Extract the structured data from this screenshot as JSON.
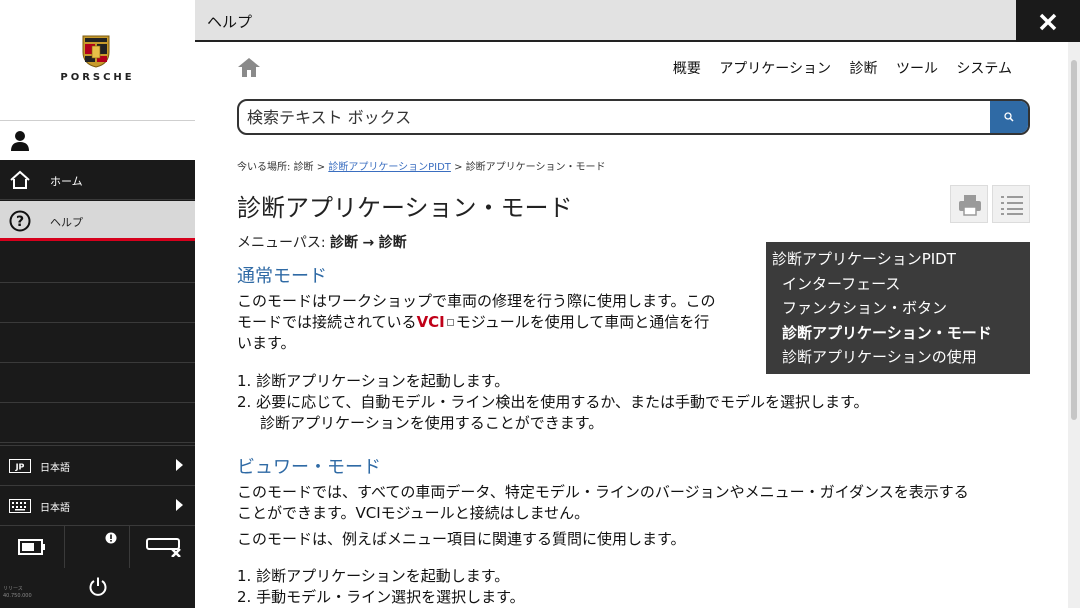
{
  "sidebar": {
    "brand": "PORSCHE",
    "nav": [
      {
        "label": "ホーム",
        "icon": "home-icon"
      },
      {
        "label": "ヘルプ",
        "icon": "help-icon"
      }
    ],
    "languages": [
      {
        "badge": "JP",
        "label": "日本語",
        "icon": "language-flag-icon"
      },
      {
        "label": "日本語",
        "icon": "keyboard-icon"
      }
    ],
    "version": [
      "リリース",
      "40.750.000"
    ]
  },
  "header": {
    "title": "ヘルプ"
  },
  "topnav": [
    "概要",
    "アプリケーション",
    "診断",
    "ツール",
    "システム"
  ],
  "search": {
    "placeholder": "検索テキスト ボックス"
  },
  "breadcrumb": {
    "prefix": "今いる場所:",
    "items": [
      "診断",
      "診断アプリケーションPIDT",
      "診断アプリケーション・モード"
    ],
    "sep": ">"
  },
  "page": {
    "title": "診断アプリケーション・モード",
    "menu_path_label": "メニューパス:",
    "menu_path_from": "診断",
    "menu_path_arrow": "→",
    "menu_path_to": "診断"
  },
  "toc": {
    "root": "診断アプリケーションPIDT",
    "items": [
      "インターフェース",
      "ファンクション・ボタン",
      "診断アプリケーション・モード",
      "診断アプリケーションの使用"
    ]
  },
  "sections": {
    "normal": {
      "heading": "通常モード",
      "para_line1": "このモードはワークショップで車両の修理を行う際に使用します。この",
      "para_line2_a": "モードでは接続されている",
      "para_line2_vci": "VCI",
      "para_line2_b": "モジュールを使用して車両と通信を行",
      "para_line3": "います。",
      "steps": [
        "1. 診断アプリケーションを起動します。",
        "2. 必要に応じて、自動モデル・ライン検出を使用するか、または手動でモデルを選択します。",
        "診断アプリケーションを使用することができます。"
      ]
    },
    "viewer": {
      "heading": "ビュワー・モード",
      "para1_line1": "このモードでは、すべての車両データ、特定モデル・ラインのバージョンやメニュー・ガイダンスを表示する",
      "para1_line2": "ことができます。VCIモジュールと接続はしません。",
      "para2": "このモードは、例えばメニュー項目に関連する質問に使用します。",
      "steps": [
        "1. 診断アプリケーションを起動します。",
        "2. 手動モデル・ライン選択を選択します。"
      ]
    }
  },
  "colors": {
    "accent_blue": "#2f6aa5",
    "porsche_red": "#d5001c",
    "sidebar_bg": "#1a1a1a"
  }
}
